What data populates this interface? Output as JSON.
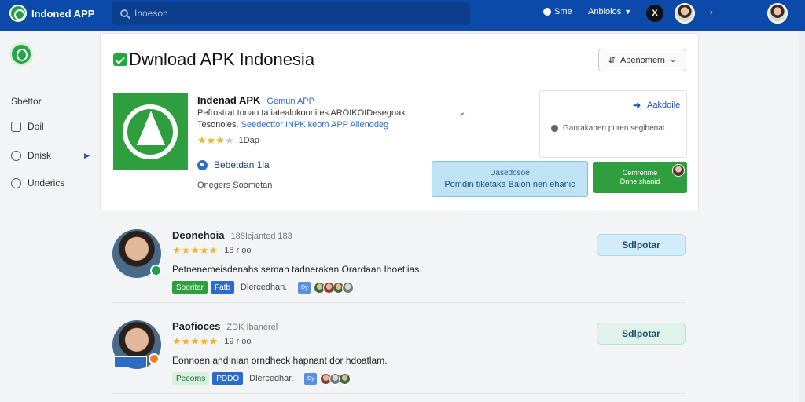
{
  "topbar": {
    "brand": "Indoned APP",
    "search_placeholder": "Inoeson",
    "item1": "Sme",
    "item2": "Anbiolos",
    "x_label": "X"
  },
  "sidebar": {
    "items": [
      {
        "label": "Sbettor"
      },
      {
        "label": "Doil"
      },
      {
        "label": "Dnisk"
      },
      {
        "label": "Underics"
      }
    ]
  },
  "header": {
    "title": "Dwnload APK Indonesia",
    "sort_label": "Apenomern",
    "sort_icon": "sliders-icon"
  },
  "app": {
    "name": "Indenad APK",
    "tag": "Gemun APP",
    "description": "Pefrostrat tonao ta iatealokoonites AROIKOIDesegoak",
    "sub_prefix": "Tesonoles.",
    "sub_link": "Seedecttor INPK keom APP Alienodeg",
    "rating_text": "1Dap",
    "rating_stars": 3,
    "developer": "Bebetdan 1la",
    "developer_sub": "Onegers Soometan"
  },
  "download": {
    "link_label": "Aakdoile",
    "note": "Gaorakahen puren segibenat..",
    "blue_cta_line1": "Dasedosoe",
    "blue_cta_line2": "Pomdin tiketaka Balon nen ehanic",
    "green_cta_line1": "Cemrenme",
    "green_cta_line2": "Dnne shanid"
  },
  "reviews": [
    {
      "name": "Deonehoia",
      "meta": "188Icjanted 183",
      "stars": 5,
      "rating_text": "18 r oo",
      "text": "Petnenemeisdenahs semah tadnerakan Orardaan Ihoetlias.",
      "tag1": "Sooritar",
      "tag2": "Fatb",
      "tag_text": "Dlercedhan.",
      "badge": "Dy",
      "action": "Sdlpotar"
    },
    {
      "name": "Paofioces",
      "meta": "ZDK Ibanerel",
      "stars": 5,
      "rating_text": "19 r oo",
      "text": "Eonnoen and nian orndheck hapnant dor hdoatlam.",
      "tag1": "Peeorns",
      "tag2": "PDDO",
      "tag_text": "Dlercedhar.",
      "badge": "Dy",
      "action": "Sdlpotar"
    }
  ]
}
